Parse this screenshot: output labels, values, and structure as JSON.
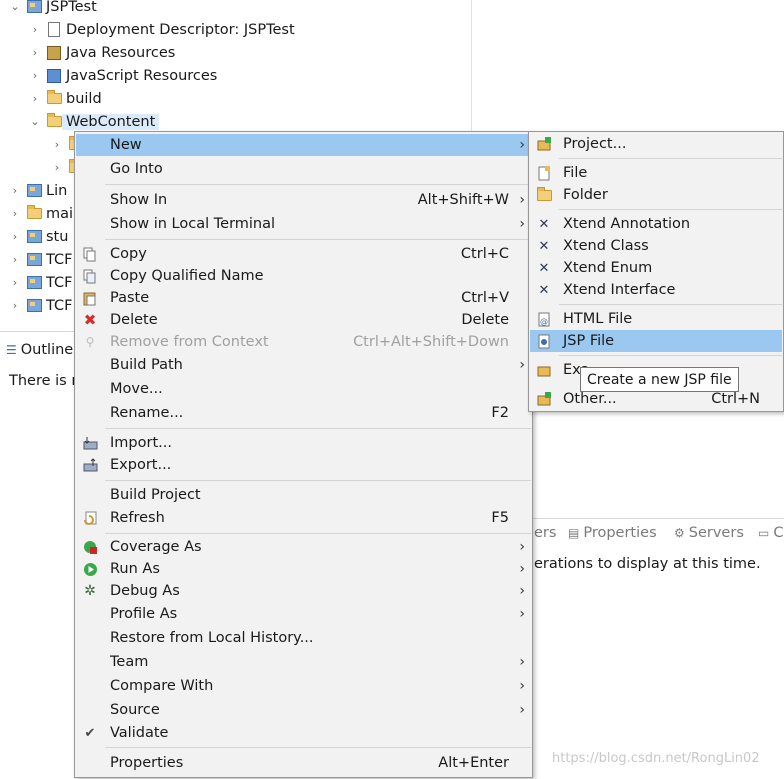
{
  "explorer": {
    "rows": [
      {
        "label": "JSPTest",
        "icon": "project-icon",
        "chevron": "expanded"
      },
      {
        "label": "Deployment Descriptor: JSPTest",
        "icon": "deployment-descriptor-icon",
        "chevron": "collapsed"
      },
      {
        "label": "Java Resources",
        "icon": "java-resources-icon",
        "chevron": "collapsed"
      },
      {
        "label": "JavaScript Resources",
        "icon": "javascript-resources-icon",
        "chevron": "collapsed"
      },
      {
        "label": "build",
        "icon": "folder-icon",
        "chevron": "collapsed"
      },
      {
        "label": "WebContent",
        "icon": "folder-open-icon",
        "chevron": "expanded"
      },
      {
        "label": "Lin",
        "icon": "project-icon",
        "chevron": "collapsed"
      },
      {
        "label": "mai",
        "icon": "folder-icon",
        "chevron": "collapsed"
      },
      {
        "label": "stu",
        "icon": "project-icon",
        "chevron": "collapsed"
      },
      {
        "label": "TCF",
        "icon": "project-icon",
        "chevron": "collapsed"
      },
      {
        "label": "TCF",
        "icon": "project-icon",
        "chevron": "collapsed"
      },
      {
        "label": "TCF",
        "icon": "project-icon",
        "chevron": "collapsed"
      }
    ]
  },
  "outline": {
    "tab": "Outline",
    "message": "There is n"
  },
  "bottom_panel": {
    "tabs": [
      {
        "label": "ers"
      },
      {
        "label": "Properties"
      },
      {
        "label": "Servers"
      },
      {
        "label": "C"
      }
    ],
    "message": "erations to display at this time."
  },
  "context_menu": {
    "new": "New",
    "go_into": "Go Into",
    "show_in": {
      "label": "Show In",
      "accel": "Alt+Shift+W"
    },
    "show_in_terminal": "Show in Local Terminal",
    "copy": {
      "label": "Copy",
      "accel": "Ctrl+C"
    },
    "copy_qualified": "Copy Qualified Name",
    "paste": {
      "label": "Paste",
      "accel": "Ctrl+V"
    },
    "delete": {
      "label": "Delete",
      "accel": "Delete"
    },
    "remove_ctx": {
      "label": "Remove from Context",
      "accel": "Ctrl+Alt+Shift+Down"
    },
    "build_path": "Build Path",
    "move": "Move...",
    "rename": {
      "label": "Rename...",
      "accel": "F2"
    },
    "import": "Import...",
    "export": "Export...",
    "build_project": "Build Project",
    "refresh": {
      "label": "Refresh",
      "accel": "F5"
    },
    "coverage_as": "Coverage As",
    "run_as": "Run As",
    "debug_as": "Debug As",
    "profile_as": "Profile As",
    "restore_history": "Restore from Local History...",
    "team": "Team",
    "compare_with": "Compare With",
    "source": "Source",
    "validate": "Validate",
    "properties": {
      "label": "Properties",
      "accel": "Alt+Enter"
    }
  },
  "new_submenu": {
    "project": "Project...",
    "file": "File",
    "folder": "Folder",
    "xtend_annotation": "Xtend Annotation",
    "xtend_class": "Xtend Class",
    "xtend_enum": "Xtend Enum",
    "xtend_interface": "Xtend Interface",
    "html_file": "HTML File",
    "jsp_file": "JSP File",
    "example": "Exa",
    "other": {
      "label": "Other...",
      "accel": "Ctrl+N"
    }
  },
  "tooltip": "Create a new JSP file",
  "watermark": "https://blog.csdn.net/RongLin02",
  "colors": {
    "highlight": "#9ac8f0",
    "menu_bg": "#f2f2f2",
    "selection": "#dcebfb"
  }
}
